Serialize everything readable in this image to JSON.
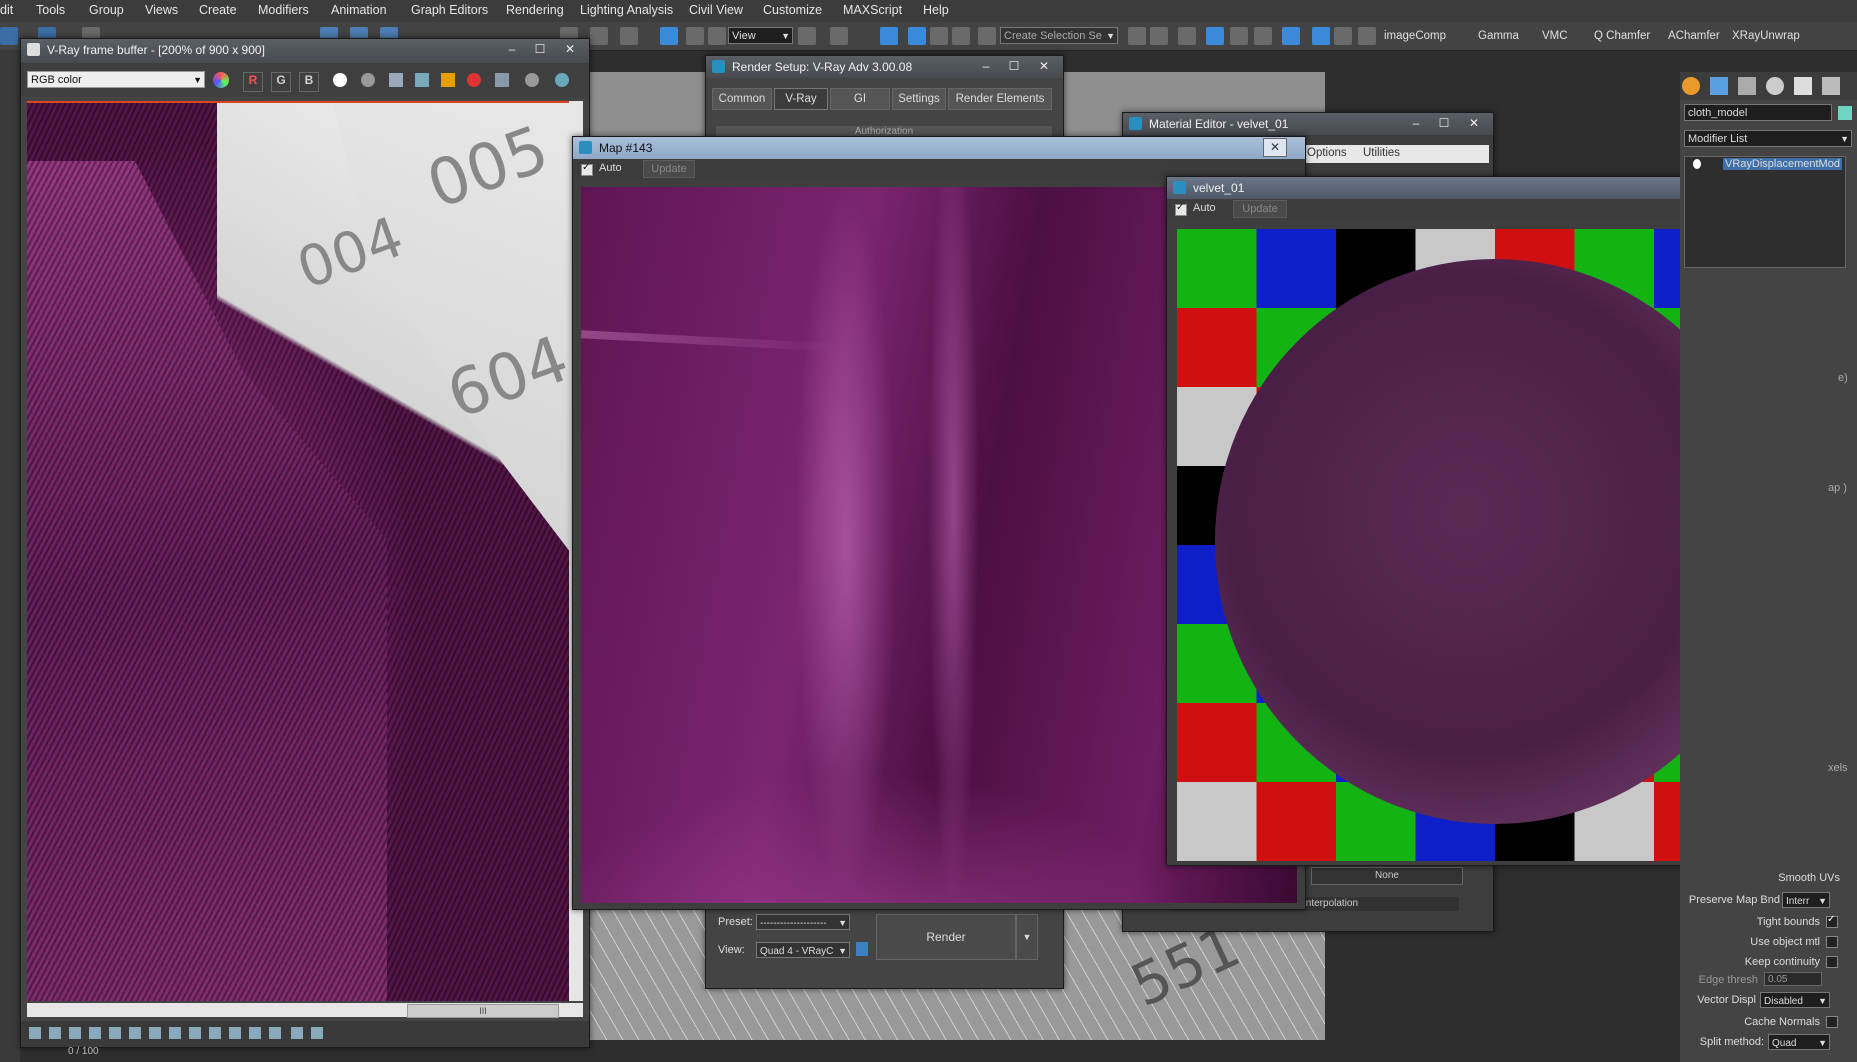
{
  "menu": [
    "dit",
    "Tools",
    "Group",
    "Views",
    "Create",
    "Modifiers",
    "Animation",
    "Graph Editors",
    "Rendering",
    "Lighting Analysis",
    "Civil View",
    "Customize",
    "MAXScript",
    "Help"
  ],
  "toolbar": {
    "view_dropdown": "View",
    "selection_set": "Create Selection Se",
    "scripts": [
      "imageComp",
      "Gamma",
      "VMC",
      "Q Chamfer",
      "AChamfer",
      "XRayUnwrap"
    ]
  },
  "vfb": {
    "title": "V-Ray frame buffer - [200% of 900 x 900]",
    "channel": "RGB color",
    "r": "R",
    "g": "G",
    "b": "B",
    "status": "0 / 100",
    "scroll_grip": "III"
  },
  "render_setup": {
    "title": "Render Setup: V-Ray Adv 3.00.08",
    "tabs": [
      "Common",
      "V-Ray",
      "GI",
      "Settings",
      "Render Elements"
    ],
    "rollout": "Authorization",
    "preset_label": "Preset:",
    "preset_value": "--------------------",
    "view_label": "View:",
    "view_value": "Quad 4 - VRayC",
    "render_button": "Render"
  },
  "mat_editor": {
    "title": "Material Editor - velvet_01",
    "menu": [
      "Options",
      "Utilities"
    ],
    "none_button": "None",
    "interp": "Interpolation"
  },
  "map_window": {
    "title": "Map #143",
    "auto": "Auto",
    "update": "Update"
  },
  "velvet_window": {
    "title": "velvet_01",
    "auto": "Auto",
    "update": "Update"
  },
  "viewport": {
    "labels": [
      "005",
      "004",
      "604",
      "551"
    ]
  },
  "command_panel": {
    "object_name": "cloth_model",
    "modifier_list": "Modifier List",
    "stack_item": "VRayDisplacementMod",
    "smooth_uvs": "Smooth UVs",
    "preserve_map_bnd": "Preserve Map Bnd",
    "preserve_value": "Interr",
    "tight_bounds": "Tight bounds",
    "use_object_mtl": "Use object mtl",
    "keep_continuity": "Keep continuity",
    "edge_thresh": "Edge thresh",
    "edge_value": "0.05",
    "vector_displ": "Vector Displ",
    "vector_value": "Disabled",
    "cache_normals": "Cache Normals",
    "split_method": "Split method:",
    "split_value": "Quad",
    "side_texts": [
      "e)",
      "ap )",
      "xels"
    ]
  },
  "colors": {
    "accent": "#2a8fbf",
    "close": "#c03a2b",
    "velvet": "#6b1b5a"
  }
}
